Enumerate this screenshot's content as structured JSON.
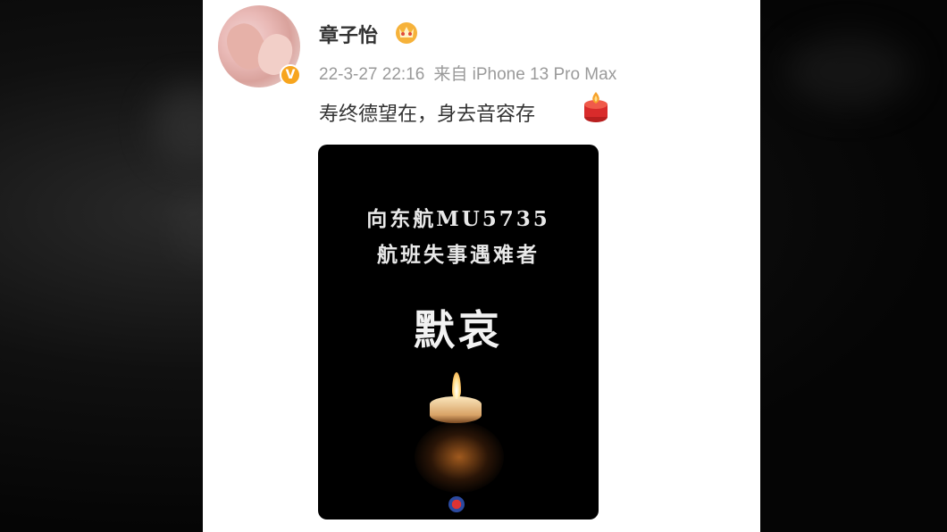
{
  "post": {
    "username": "章子怡",
    "timestamp": "22-3-27 22:16",
    "source": "来自 iPhone 13 Pro Max",
    "text": "寿终德望在，身去音容存",
    "verified_badge": "V"
  },
  "image": {
    "line1": "向东航MU5735",
    "line2": "航班失事遇难者",
    "title": "默哀"
  },
  "icons": {
    "crown": "crown-icon",
    "candle": "candle-icon",
    "verified": "verified-icon"
  },
  "colors": {
    "badge": "#f7a51e",
    "username": "#333333",
    "meta": "#9a9a9a"
  }
}
